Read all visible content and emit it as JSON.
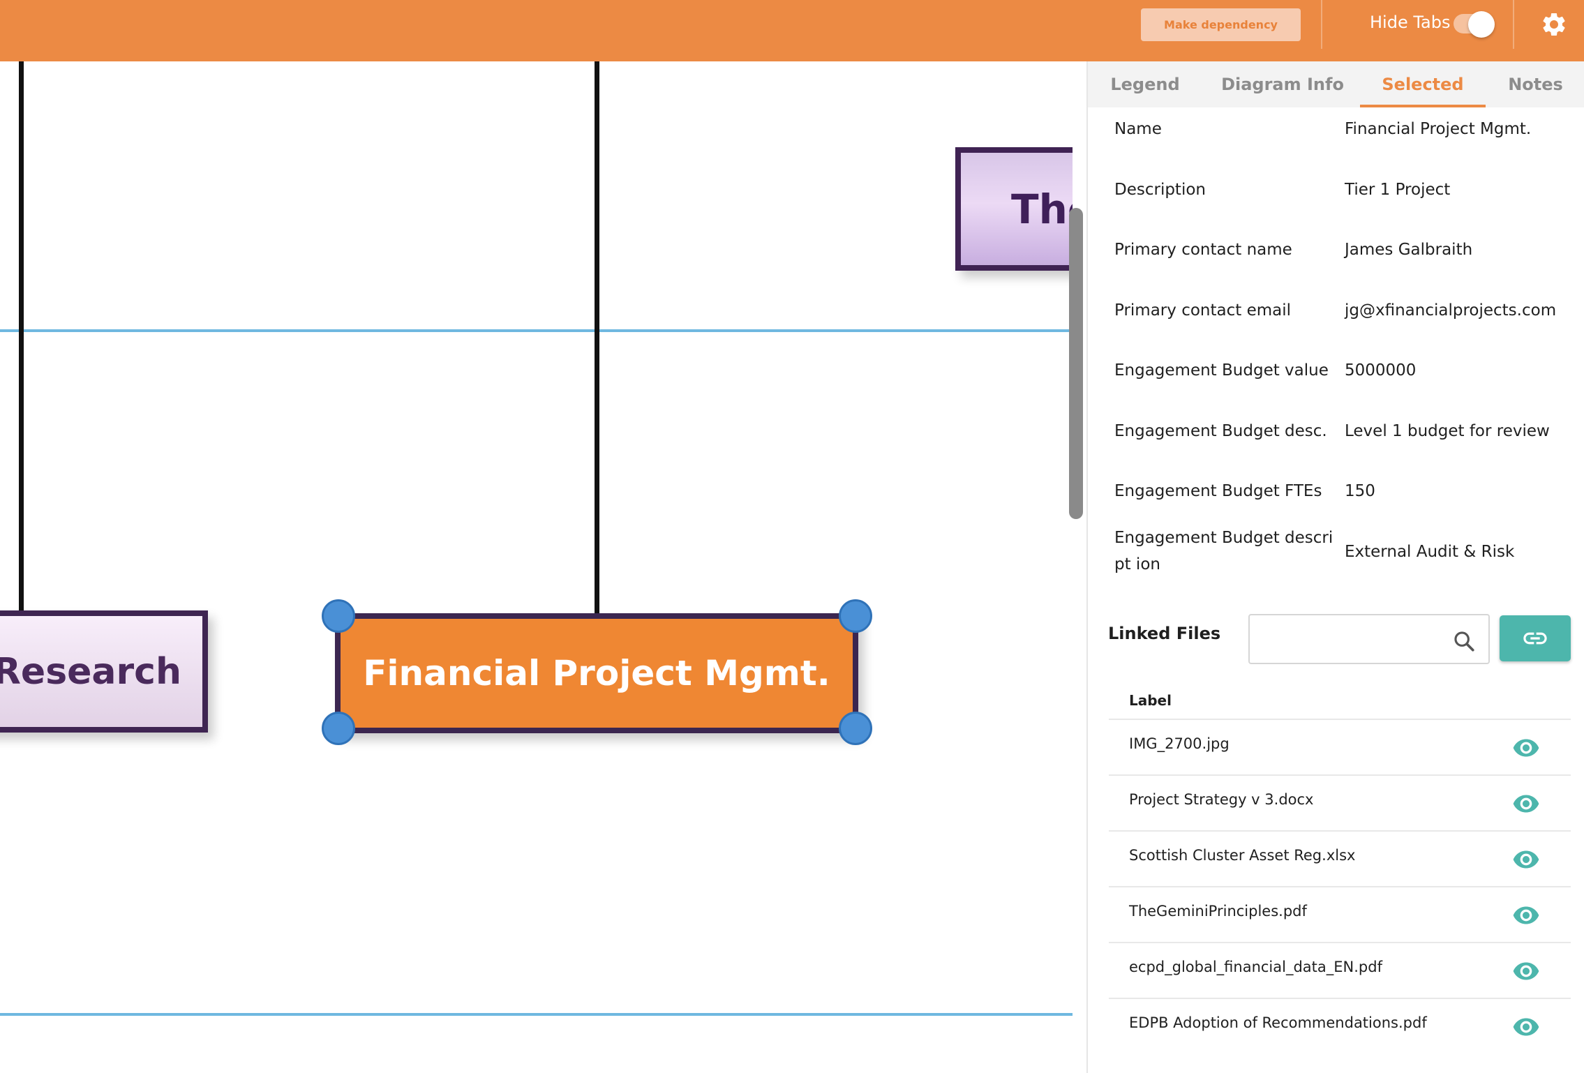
{
  "toolbar": {
    "make_dependency_label": "Make dependency",
    "hide_tabs_label": "Hide Tabs",
    "hide_tabs_on": true,
    "accent_color": "#ec8a44"
  },
  "canvas": {
    "nodes": {
      "research": "c Research",
      "financial": "Financial Project Mgmt.",
      "the": "The"
    }
  },
  "panel": {
    "tabs": [
      {
        "label": "Legend",
        "active": false
      },
      {
        "label": "Diagram Info",
        "active": false
      },
      {
        "label": "Selected",
        "active": true
      },
      {
        "label": "Notes",
        "active": false
      }
    ],
    "properties": [
      {
        "label": "Name",
        "value": "Financial Project Mgmt."
      },
      {
        "label": "Description",
        "value": "Tier 1 Project"
      },
      {
        "label": "Primary contact name",
        "value": "James Galbraith"
      },
      {
        "label": "Primary contact email",
        "value": "jg@xfinancialprojects.com"
      },
      {
        "label": "Engagement Budget value",
        "value": "5000000"
      },
      {
        "label": "Engagement Budget desc.",
        "value": "Level 1 budget for review"
      },
      {
        "label": "Engagement Budget FTEs",
        "value": "150"
      },
      {
        "label": "Engagement Budget descript ion",
        "value": "External Audit & Risk"
      }
    ],
    "linked_files": {
      "title": "Linked Files",
      "search_value": "",
      "column_label": "Label",
      "files": [
        "IMG_2700.jpg",
        "Project Strategy v 3.docx",
        "Scottish Cluster Asset Reg.xlsx",
        "TheGeminiPrinciples.pdf",
        "ecpd_global_financial_data_EN.pdf",
        "EDPB Adoption of Recommendations.pdf"
      ]
    }
  },
  "icons": {
    "settings": "gear-icon",
    "search": "search-icon",
    "link": "link-icon",
    "view": "eye-icon"
  }
}
